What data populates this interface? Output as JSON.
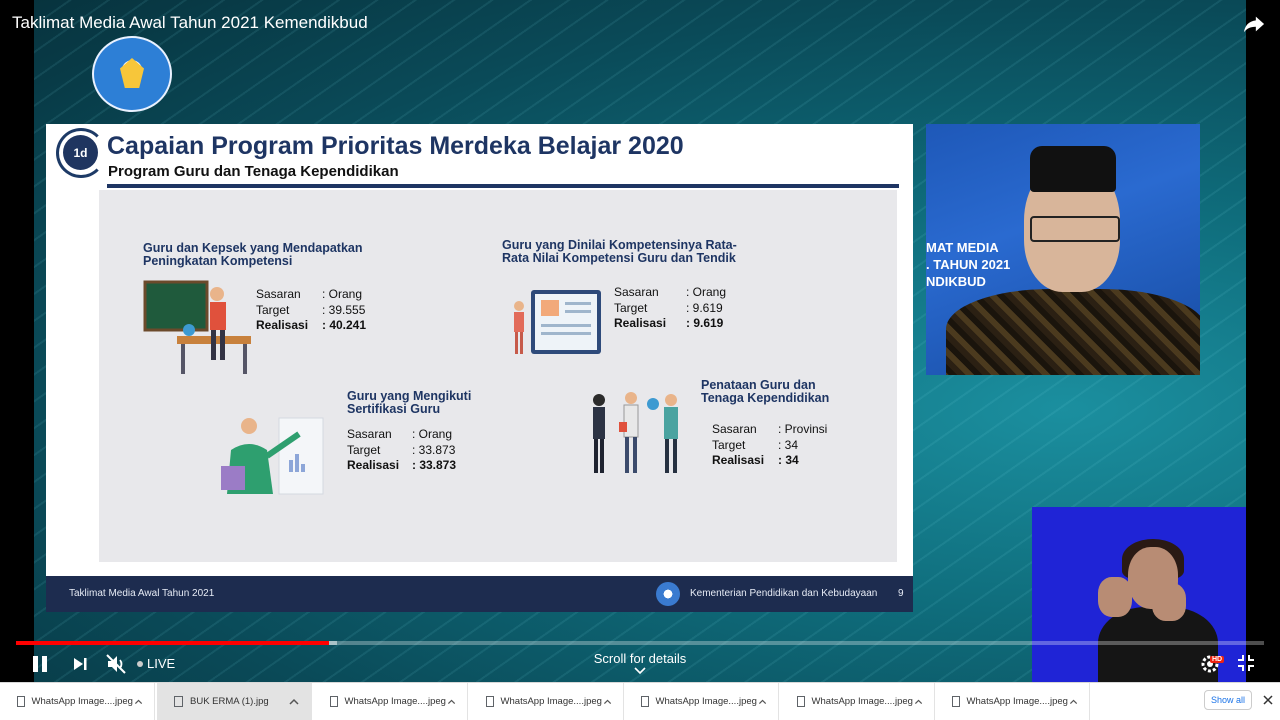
{
  "video": {
    "title": "Taklimat Media Awal Tahun 2021 Kemendikbud",
    "progress_played": 0.251,
    "progress_buffered": 0.257
  },
  "slide": {
    "number": "1d",
    "title": "Capaian Program Prioritas Merdeka Belajar 2020",
    "subtitle": "Program Guru dan Tenaga Kependidikan",
    "blocks": [
      {
        "title_l1": "Guru dan Kepsek yang Mendapatkan",
        "title_l2": "Peningkatan Kompetensi",
        "rows": [
          {
            "label": "Sasaran",
            "value": ": Orang"
          },
          {
            "label": "Target",
            "value": ": 39.555"
          },
          {
            "label": "Realisasi",
            "value": ": 40.241"
          }
        ]
      },
      {
        "title_l1": "Guru yang Dinilai Kompetensinya  Rata-",
        "title_l2": "Rata Nilai Kompetensi  Guru dan Tendik",
        "rows": [
          {
            "label": "Sasaran",
            "value": ": Orang"
          },
          {
            "label": "Target",
            "value": ": 9.619"
          },
          {
            "label": "Realisasi",
            "value": ": 9.619"
          }
        ]
      },
      {
        "title_l1": "Guru yang Mengikuti",
        "title_l2": "Sertifikasi Guru",
        "rows": [
          {
            "label": "Sasaran",
            "value": ": Orang"
          },
          {
            "label": "Target",
            "value": ": 33.873"
          },
          {
            "label": "Realisasi",
            "value": ": 33.873"
          }
        ]
      },
      {
        "title_l1": "Penataan Guru  dan",
        "title_l2": "Tenaga  Kependidikan",
        "rows": [
          {
            "label": "Sasaran",
            "value": ": Provinsi"
          },
          {
            "label": "Target",
            "value": ": 34"
          },
          {
            "label": "Realisasi",
            "value": ": 34"
          }
        ]
      }
    ],
    "footer_left": "Taklimat Media Awal Tahun 2021",
    "footer_right": "Kementerian Pendidikan dan Kebudayaan",
    "page": "9"
  },
  "speaker": {
    "banner_l1": "MAT MEDIA",
    "banner_l2": ". TAHUN 2021",
    "banner_l3": "NDIKBUD"
  },
  "player": {
    "live_label": "LIVE",
    "scroll_label": "Scroll for details",
    "hd_badge": "HD"
  },
  "downloads": {
    "items": [
      {
        "name": "WhatsApp Image....jpeg"
      },
      {
        "name": "BUK ERMA (1).jpg"
      },
      {
        "name": "WhatsApp Image....jpeg"
      },
      {
        "name": "WhatsApp Image....jpeg"
      },
      {
        "name": "WhatsApp Image....jpeg"
      },
      {
        "name": "WhatsApp Image....jpeg"
      },
      {
        "name": "WhatsApp Image....jpeg"
      }
    ],
    "show_all": "Show all"
  }
}
